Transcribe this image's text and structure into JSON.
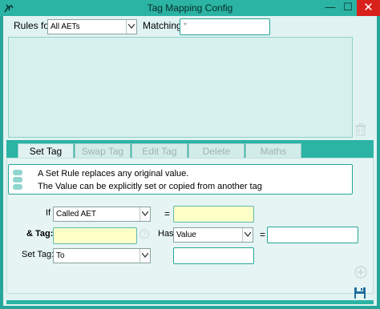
{
  "window": {
    "title": "Tag Mapping Config",
    "minimize_glyph": "—",
    "maximize_glyph": "☐",
    "close_glyph": "✕",
    "accent_color": "#26a69a",
    "close_color": "#d9211c"
  },
  "filter": {
    "rules_for_label": "Rules for",
    "rules_for_value": "All AETs",
    "matching_label": "Matching",
    "matching_value": "*"
  },
  "tabs": [
    {
      "label": "Set Tag",
      "active": true
    },
    {
      "label": "Swap Tag",
      "active": false
    },
    {
      "label": "Edit Tag",
      "active": false
    },
    {
      "label": "Delete",
      "active": false
    },
    {
      "label": "Maths",
      "active": false
    }
  ],
  "info": {
    "line1": "A Set Rule replaces any original value.",
    "line2": "The Value can be explicitly set or copied from another tag"
  },
  "form": {
    "if_label": "If",
    "if_value": "Called AET",
    "equals1": "=",
    "if_match_value": "",
    "and_tag_label": "& Tag:",
    "and_tag_value": "",
    "help_glyph": "?",
    "has_label": "Has",
    "has_value": "Value",
    "equals2": "=",
    "has_match_value": "",
    "set_tag_label": "Set Tag:",
    "set_tag_value": "To",
    "set_value": ""
  },
  "icons": {
    "app": "app-icon",
    "trash": "trash-icon",
    "info": "info-icon",
    "add": "add-icon",
    "save": "save-icon"
  }
}
